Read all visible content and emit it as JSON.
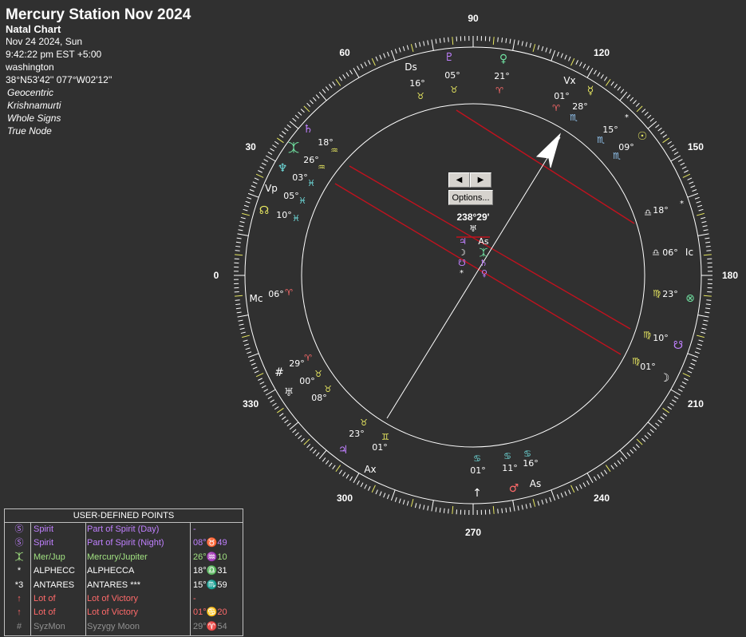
{
  "info": {
    "title": "Mercury Station Nov 2024",
    "subtitle": "Natal Chart",
    "date": "Nov 24 2024, Sun",
    "time": "9:42:22 pm  EST +5:00",
    "place": "washington",
    "coords": "38°N53'42'' 077°W02'12''",
    "mode1": "Geocentric",
    "mode2": "Krishnamurti",
    "mode3": "Whole Signs",
    "mode4": "True Node"
  },
  "colors": {
    "background": "#303030",
    "wheel": "#ffffff",
    "red_lines": "#c0121e",
    "fire": "#ff6a6a",
    "earth": "#e8e860",
    "air": "#70e0e0",
    "water": "#9ad0ff",
    "violet": "#c080ff"
  },
  "wheel": {
    "degree_labels": [
      "270",
      "240",
      "210",
      "180",
      "150",
      "120",
      "90",
      "60",
      "30",
      "0",
      "330",
      "300"
    ],
    "center_readout": "238°29'"
  },
  "nav": {
    "prev": "◀",
    "next": "▶",
    "options": "Options..."
  },
  "house_cusps": [
    {
      "deg": "16°",
      "sign": "♉",
      "color": "#e8e860"
    },
    {
      "deg": "05°",
      "sign": "♉",
      "color": "#e8e860"
    },
    {
      "deg": "21°",
      "sign": "♈",
      "color": "#ff6a6a"
    },
    {
      "deg": "01°",
      "sign": "♈",
      "color": "#ff6a6a"
    },
    {
      "deg": "28°",
      "sign": "♏",
      "color": "#9ad0ff"
    },
    {
      "deg": "15°",
      "sign": "♏",
      "color": "#9ad0ff"
    },
    {
      "deg": "09°",
      "sign": "♏",
      "color": "#9ad0ff"
    },
    {
      "deg": "18°",
      "sign": "♎",
      "color": "#e8e8e8"
    },
    {
      "deg": "06°",
      "sign": "♎",
      "color": "#e8e8e8"
    },
    {
      "deg": "23°",
      "sign": "♍",
      "color": "#e8e860"
    },
    {
      "deg": "10°",
      "sign": "♍",
      "color": "#e8e860"
    },
    {
      "deg": "01°",
      "sign": "♍",
      "color": "#e8e860"
    },
    {
      "deg": "16°",
      "sign": "♋",
      "color": "#70e0e0"
    },
    {
      "deg": "11°",
      "sign": "♋",
      "color": "#70e0e0"
    },
    {
      "deg": "01°",
      "sign": "♋",
      "color": "#70e0e0"
    },
    {
      "deg": "01°",
      "sign": "♊",
      "color": "#e8e860"
    },
    {
      "deg": "23°",
      "sign": "♉",
      "color": "#e8e860"
    },
    {
      "deg": "08°",
      "sign": "♉",
      "color": "#e8e860"
    },
    {
      "deg": "00°",
      "sign": "♉",
      "color": "#e8e860"
    },
    {
      "deg": "29°",
      "sign": "♈",
      "color": "#ff6a6a"
    },
    {
      "deg": "06°",
      "sign": "♈",
      "color": "#ff6a6a"
    },
    {
      "deg": "10°",
      "sign": "♓",
      "color": "#70e0e0"
    },
    {
      "deg": "05°",
      "sign": "♓",
      "color": "#70e0e0"
    },
    {
      "deg": "03°",
      "sign": "♓",
      "color": "#70e0e0"
    },
    {
      "deg": "26°",
      "sign": "♒",
      "color": "#e8e860"
    },
    {
      "deg": "18°",
      "sign": "♒",
      "color": "#e8e860"
    }
  ],
  "points": [
    {
      "name": "Ds",
      "glyph": "Ds",
      "color": "#ffffff"
    },
    {
      "name": "Pluto",
      "glyph": "♇",
      "color": "#c080ff"
    },
    {
      "name": "Venus",
      "glyph": "♀",
      "color": "#70e0a0"
    },
    {
      "name": "Vx",
      "glyph": "Vx",
      "color": "#ffffff"
    },
    {
      "name": "Mercury",
      "glyph": "☿",
      "color": "#e8e860"
    },
    {
      "name": "Sun",
      "glyph": "☉",
      "color": "#e8e860"
    },
    {
      "name": "Ic",
      "glyph": "Ic",
      "color": "#ffffff"
    },
    {
      "name": "Fortune",
      "glyph": "⊗",
      "color": "#70e0a0"
    },
    {
      "name": "Node",
      "glyph": "☋",
      "color": "#c080ff"
    },
    {
      "name": "Moon",
      "glyph": "☽",
      "color": "#ffffff"
    },
    {
      "name": "Lot",
      "glyph": "↑",
      "color": "#ffffff"
    },
    {
      "name": "Mars",
      "glyph": "♂",
      "color": "#ff6a6a"
    },
    {
      "name": "As",
      "glyph": "As",
      "color": "#ffffff"
    },
    {
      "name": "Ax",
      "glyph": "Ax",
      "color": "#ffffff"
    },
    {
      "name": "Jupiter",
      "glyph": "♃",
      "color": "#c080ff"
    },
    {
      "name": "Uranus",
      "glyph": "♅",
      "color": "#e8e8e8"
    },
    {
      "name": "SyzMon",
      "glyph": "#",
      "color": "#ffffff"
    },
    {
      "name": "Mc",
      "glyph": "Mc",
      "color": "#ffffff"
    },
    {
      "name": "Node",
      "glyph": "☊",
      "color": "#e8e860"
    },
    {
      "name": "Vp",
      "glyph": "Vp",
      "color": "#ffffff"
    },
    {
      "name": "Neptune",
      "glyph": "♆",
      "color": "#70e0e0"
    },
    {
      "name": "MerJup",
      "glyph": "⯰",
      "color": "#70e0a0"
    },
    {
      "name": "Saturn",
      "glyph": "♄",
      "color": "#c080ff"
    }
  ],
  "udp": {
    "header": "USER-DEFINED POINTS",
    "rows": [
      {
        "sym": "Ⓢ",
        "abbr": "Spirit",
        "name": "Part of Spirit (Day)",
        "pos": "-",
        "color": "#c080ff"
      },
      {
        "sym": "Ⓢ",
        "abbr": "Spirit",
        "name": "Part of Spirit (Night)",
        "pos": "08°♉49",
        "color": "#c080ff"
      },
      {
        "sym": "⯰",
        "abbr": "Mer/Jup",
        "name": "Mercury/Jupiter",
        "pos": "26°♒10",
        "color": "#a0e080"
      },
      {
        "sym": "*",
        "abbr": "ALPHECC",
        "name": "ALPHECCA",
        "pos": "18°♎31",
        "color": "#ffffff"
      },
      {
        "sym": "*3",
        "abbr": "ANTARES",
        "name": "ANTARES ***",
        "pos": "15°♏59",
        "color": "#ffffff"
      },
      {
        "sym": "↑",
        "abbr": "Lot of",
        "name": "Lot of Victory",
        "pos": "-",
        "color": "#ff6a6a"
      },
      {
        "sym": "↑",
        "abbr": "Lot of",
        "name": "Lot of Victory",
        "pos": "01°♋20",
        "color": "#ff6a6a"
      },
      {
        "sym": "#",
        "abbr": "SyzMon",
        "name": "Syzygy Moon",
        "pos": "29°♈54",
        "color": "#909090"
      }
    ]
  }
}
